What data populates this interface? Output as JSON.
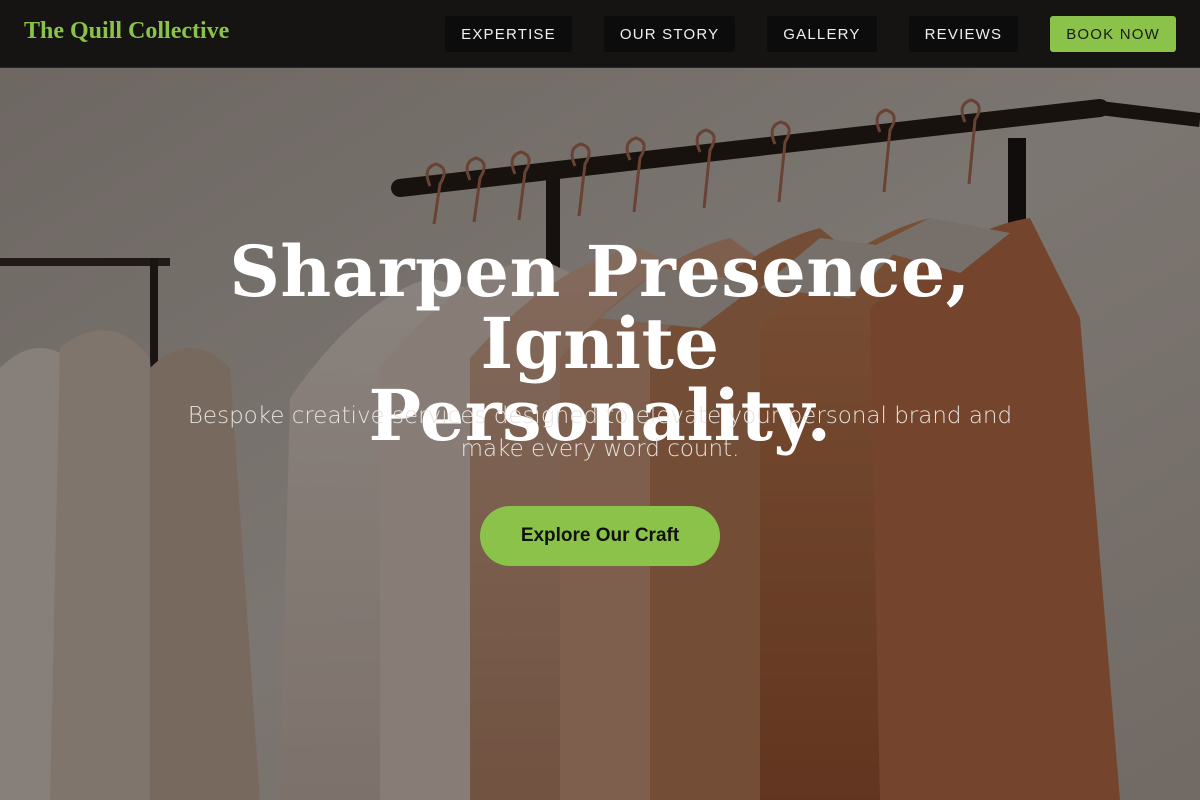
{
  "brand": {
    "name": "The Quill Collective",
    "accent_color": "#8bc34a"
  },
  "nav": {
    "items": [
      {
        "label": "EXPERTISE"
      },
      {
        "label": "OUR STORY"
      },
      {
        "label": "GALLERY"
      },
      {
        "label": "REVIEWS"
      }
    ],
    "cta_label": "BOOK NOW"
  },
  "hero": {
    "headline_line1": "Sharpen Presence, Ignite",
    "headline_line2": "Personality.",
    "subtext": "Bespoke creative services designed to elevate your personal brand and make every word count.",
    "cta_label": "Explore Our Craft",
    "background_image": "clothing-rack-photo"
  }
}
